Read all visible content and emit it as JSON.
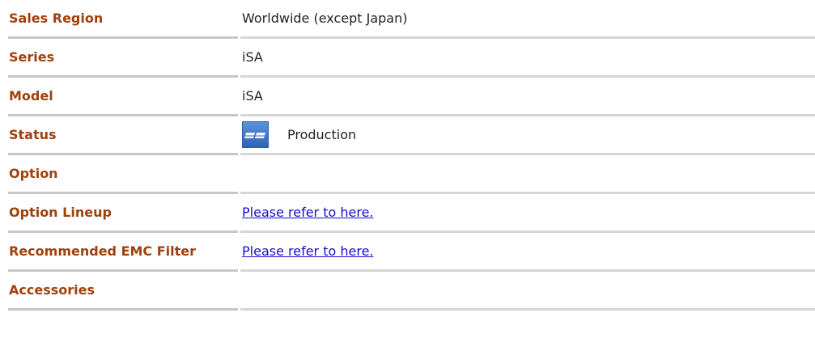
{
  "rows": [
    {
      "label": "Sales Region",
      "value": "Worldwide (except Japan)"
    },
    {
      "label": "Series",
      "value": "iSA"
    },
    {
      "label": "Model",
      "value": "iSA"
    },
    {
      "label": "Status",
      "value": "Production",
      "icon": "production-status-icon"
    },
    {
      "label": "Option",
      "value": ""
    },
    {
      "label": "Option Lineup",
      "link": "Please refer to here."
    },
    {
      "label": "Recommended EMC Filter",
      "link": "Please refer to here."
    },
    {
      "label": "Accessories",
      "value": ""
    }
  ],
  "colors": {
    "label": "#a0410d",
    "link": "#1a0dcc",
    "divider": "#c7c7c7",
    "status_icon": "#3a72c4"
  }
}
